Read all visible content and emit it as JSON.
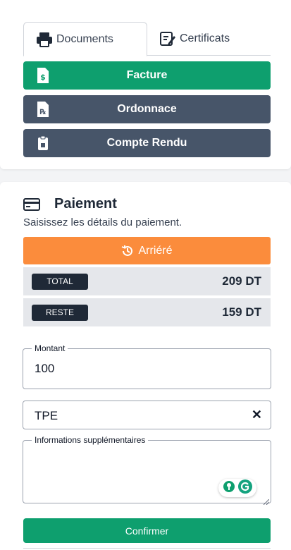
{
  "tabs": [
    {
      "label": "Documents",
      "icon": "printer-icon",
      "active": true
    },
    {
      "label": "Certificats",
      "icon": "edit-document-icon",
      "active": false
    }
  ],
  "documents": {
    "facture_label": "Facture",
    "ordonnance_label": "Ordonnace",
    "compte_rendu_label": "Compte Rendu"
  },
  "payment": {
    "title": "Paiement",
    "subtitle": "Saisissez les détails du paiement.",
    "arriere_label": "Arriéré",
    "total_label": "TOTAL",
    "total_value": "209 DT",
    "reste_label": "RESTE",
    "reste_value": "159 DT",
    "montant_label": "Montant",
    "montant_value": "100",
    "method_value": "TPE",
    "info_label": "Informations supplémentaires",
    "info_value": "",
    "confirm_label": "Confirmer"
  },
  "colors": {
    "green": "#0e9f6e",
    "slate": "#475569",
    "orange": "#fb8c3c",
    "dark": "#1f2937"
  }
}
